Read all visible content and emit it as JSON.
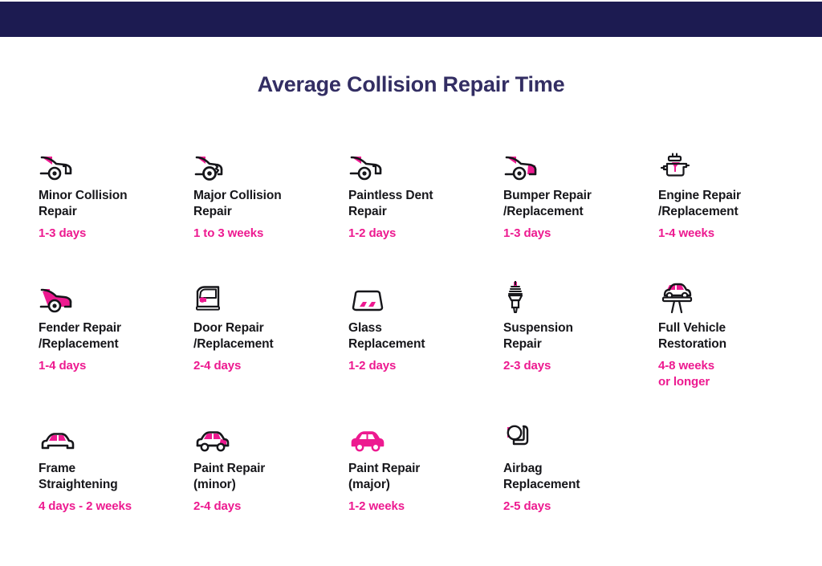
{
  "header": {
    "bar_color": "#1c1b51"
  },
  "title": "Average Collision Repair Time",
  "colors": {
    "navy": "#1c1b51",
    "title": "#332e63",
    "pink": "#ed1a90",
    "ink": "#16161a"
  },
  "items": [
    {
      "icon": "car-front-damage-icon",
      "label": "Minor Collision\nRepair",
      "duration": "1-3 days"
    },
    {
      "icon": "car-front-crushed-icon",
      "label": "Major Collision\nRepair",
      "duration": "1 to 3 weeks"
    },
    {
      "icon": "car-dent-icon",
      "label": "Paintless Dent\nRepair",
      "duration": "1-2 days"
    },
    {
      "icon": "car-bumper-icon",
      "label": "Bumper Repair\n/Replacement",
      "duration": "1-3 days"
    },
    {
      "icon": "engine-block-icon",
      "label": "Engine Repair\n/Replacement",
      "duration": "1-4 weeks"
    },
    {
      "icon": "car-fender-icon",
      "label": "Fender Repair\n/Replacement",
      "duration": "1-4 days"
    },
    {
      "icon": "car-door-icon",
      "label": "Door Repair\n/Replacement",
      "duration": "2-4 days"
    },
    {
      "icon": "windshield-icon",
      "label": "Glass\nReplacement",
      "duration": "1-2 days"
    },
    {
      "icon": "shock-absorber-icon",
      "label": "Suspension\nRepair",
      "duration": "2-3 days"
    },
    {
      "icon": "car-on-lift-icon",
      "label": "Full Vehicle\nRestoration",
      "duration": "4-8 weeks\nor longer"
    },
    {
      "icon": "car-frame-icon",
      "label": "Frame\nStraightening",
      "duration": "4 days - 2 weeks"
    },
    {
      "icon": "car-paint-minor-icon",
      "label": "Paint Repair\n(minor)",
      "duration": "2-4 days"
    },
    {
      "icon": "car-paint-major-icon",
      "label": "Paint Repair\n(major)",
      "duration": "1-2 weeks"
    },
    {
      "icon": "airbag-seat-icon",
      "label": "Airbag\nReplacement",
      "duration": "2-5 days"
    }
  ]
}
